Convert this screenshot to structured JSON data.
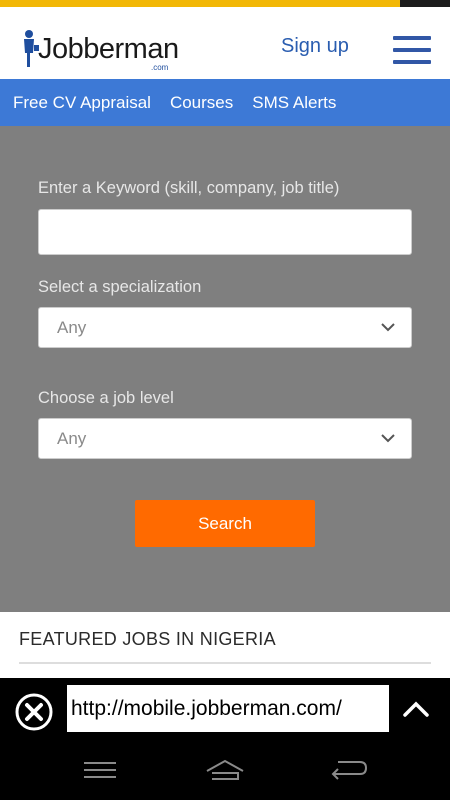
{
  "header": {
    "logo_text": "Jobberman",
    "logo_suffix": ".com",
    "signup_label": "Sign up",
    "menu_icon": "hamburger-menu-icon"
  },
  "nav": {
    "items": [
      {
        "label": "Free CV Appraisal"
      },
      {
        "label": "Courses"
      },
      {
        "label": "SMS Alerts"
      }
    ]
  },
  "search": {
    "keyword_label": "Enter a Keyword (skill, company, job title)",
    "keyword_value": "",
    "specialization_label": "Select a specialization",
    "specialization_value": "Any",
    "level_label": "Choose a job level",
    "level_value": "Any",
    "button_label": "Search"
  },
  "featured": {
    "title": "FEATURED JOBS IN NIGERIA"
  },
  "browser": {
    "url": "http://mobile.jobberman.com/"
  },
  "colors": {
    "stripe_yellow": "#f2b705",
    "nav_blue": "#3d79d6",
    "panel_gray": "#7f7f7f",
    "button_orange": "#ff6a00",
    "link_blue": "#2a5db0"
  }
}
